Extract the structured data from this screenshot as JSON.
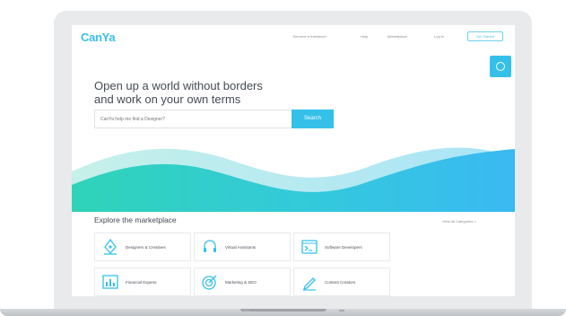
{
  "nav": {
    "logo": "CanYa",
    "links": [
      "Become a freelancer",
      "Help",
      "Marketplace",
      "Log in"
    ],
    "signup": "Get Started"
  },
  "hero": {
    "title_line1": "Open up a world without borders",
    "title_line2": "and work on your own terms",
    "search_placeholder": "CanYa help me find a Designer?",
    "search_button": "Search"
  },
  "marketplace": {
    "title": "Explore the marketplace",
    "view_all": "View All Categories  >",
    "categories": [
      {
        "label": "Designers & Creatives",
        "icon": "pen-tool-icon"
      },
      {
        "label": "Virtual Assistants",
        "icon": "headset-icon"
      },
      {
        "label": "Software Developers",
        "icon": "terminal-icon"
      },
      {
        "label": "Financial Experts",
        "icon": "chart-icon"
      },
      {
        "label": "Marketing & SEO",
        "icon": "target-icon"
      },
      {
        "label": "Content Creators",
        "icon": "pencil-icon"
      }
    ]
  },
  "colors": {
    "accent": "#35c0ea",
    "wave_light": "#b9ecee",
    "wave_teal": "#2fd3b8",
    "text_dark": "#444b54"
  }
}
